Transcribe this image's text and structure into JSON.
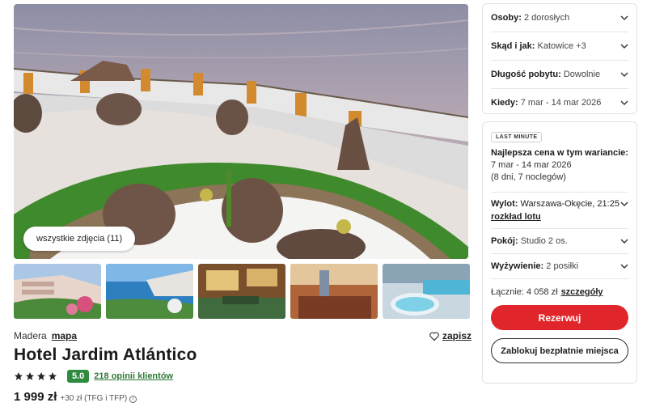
{
  "gallery": {
    "all_photos_label": "wszystkie zdjęcia (11)"
  },
  "hotel": {
    "region": "Madera",
    "map_link": "mapa",
    "save_label": "zapisz",
    "name": "Hotel Jardim Atlántico",
    "stars": 4,
    "score": "5.0",
    "reviews_label": "218 opinii klientów",
    "price": "1 999 zł",
    "price_extra": "+30 zł (TFG i TFP)",
    "info_icon": "i"
  },
  "search": {
    "persons_label": "Osoby:",
    "persons_value": "2 dorosłych",
    "from_label": "Skąd i jak:",
    "from_value": "Katowice +3",
    "duration_label": "Długość pobytu:",
    "duration_value": "Dowolnie",
    "when_label": "Kiedy:",
    "when_value": "7 mar - 14 mar 2026"
  },
  "offer": {
    "badge": "LAST MINUTE",
    "best_title": "Najlepsza cena w tym wariancie:",
    "best_dates": "7 mar - 14 mar 2026",
    "best_nights": "(8 dni, 7 noclegów)",
    "flight_label": "Wylot:",
    "flight_value": "Warszawa-Okęcie, 21:25",
    "flight_link": "rozkład lotu",
    "room_label": "Pokój:",
    "room_value": "Studio 2 os.",
    "board_label": "Wyżywienie:",
    "board_value": "2 posiłki",
    "total_label": "Łącznie: 4 058 zł",
    "total_link": "szczegóły",
    "book_button": "Rezerwuj",
    "hold_button": "Zablokuj bezpłatnie miejsca"
  },
  "colors": {
    "accent_red": "#e0262a",
    "score_green": "#2e8b3e"
  }
}
